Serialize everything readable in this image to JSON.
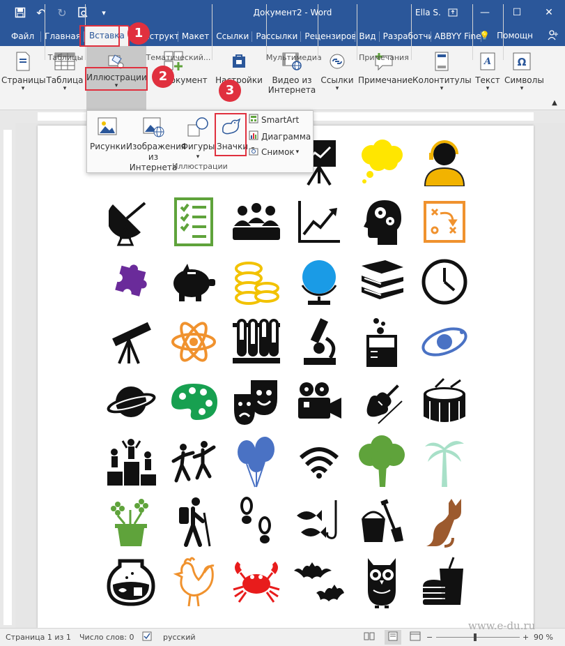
{
  "window": {
    "title": "Документ2 - Word",
    "user": "Ella S."
  },
  "tabs": [
    "Файл",
    "Главная",
    "Вставка",
    "Конструктор",
    "Макет",
    "Ссылки",
    "Рассылки",
    "Рецензиров",
    "Вид",
    "Разработчи",
    "ABBYY Fine"
  ],
  "tabs_right": {
    "help": "Помощн"
  },
  "ribbon": {
    "pages": "Страницы",
    "table": "Таблица",
    "illustrations": "Иллюстрации",
    "doc_fragment": "документ",
    "addins": "Настройки",
    "video": "Видео из Интернета",
    "links": "Ссылки",
    "comment": "Примечание",
    "header_footer": "Колонтитулы",
    "text": "Текст",
    "symbols": "Символы",
    "group_tables": "Таблицы",
    "group_themes": "Тематический...",
    "group_media": "Мультимедиа",
    "group_comments": "Примечания"
  },
  "dropdown": {
    "pictures": "Рисунки",
    "online_pictures": "Изображения из Интернета",
    "shapes": "Фигуры",
    "icons": "Значки",
    "smartart": "SmartArt",
    "chart": "Диаграмма",
    "screenshot": "Снимок",
    "group_label": "Иллюстрации"
  },
  "callouts": [
    "1",
    "2",
    "3"
  ],
  "grid_icons": [
    [
      "people-icon",
      "team-icon",
      "projector-icon",
      "presentation-board-icon",
      "thought-bubble-icon",
      "support-agent-icon"
    ],
    [
      "satellite-dish-icon",
      "checklist-icon",
      "meeting-icon",
      "growth-chart-icon",
      "brain-gears-icon",
      "strategy-board-icon"
    ],
    [
      "puzzle-icon",
      "piggy-bank-icon",
      "coins-icon",
      "globe-icon",
      "books-icon",
      "clock-icon"
    ],
    [
      "telescope-icon",
      "atom-icon",
      "test-tubes-icon",
      "microscope-icon",
      "beaker-icon",
      "galaxy-icon"
    ],
    [
      "planet-icon",
      "paint-palette-icon",
      "theater-masks-icon",
      "film-camera-icon",
      "violin-icon",
      "drum-icon"
    ],
    [
      "podium-icon",
      "dancing-icon",
      "balloons-icon",
      "wifi-icon",
      "tree-icon",
      "palm-tree-icon"
    ],
    [
      "flower-pot-icon",
      "hiker-icon",
      "footprints-icon",
      "fishing-icon",
      "sand-bucket-icon",
      "cat-icon"
    ],
    [
      "fishbowl-icon",
      "rooster-icon",
      "crab-icon",
      "bats-icon",
      "owl-icon",
      "fast-food-icon"
    ]
  ],
  "colors": {
    "word_blue": "#2b579a",
    "accent_red": "#e0303e",
    "yellow": "#ffe600",
    "green": "#5fa33b",
    "orange": "#f0922e",
    "purple": "#6a2b9a",
    "blue": "#1a9be6",
    "gold": "#f2c200",
    "red": "#e81c1c",
    "brown": "#9c5a2e",
    "balloon_blue": "#4a72c4"
  },
  "status": {
    "page": "Страница 1 из 1",
    "words": "Число слов: 0",
    "language": "русский",
    "zoom": "90 %"
  },
  "watermark": "www.e-du.ru"
}
